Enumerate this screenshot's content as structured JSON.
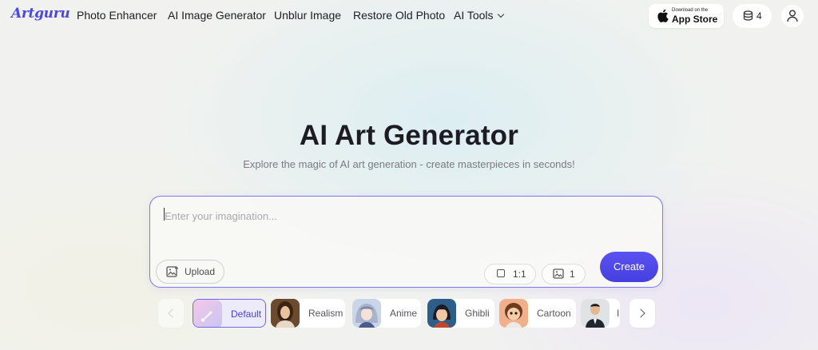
{
  "header": {
    "logo": "Artguru",
    "nav": [
      {
        "label": "Photo Enhancer"
      },
      {
        "label": "AI Image Generator"
      },
      {
        "label": "Unblur Image"
      },
      {
        "label": "Restore Old Photo"
      },
      {
        "label": "AI Tools"
      }
    ],
    "app_store": {
      "small": "Download on the",
      "big": "App Store"
    },
    "credits": "4"
  },
  "hero": {
    "title": "AI Art Generator",
    "subtitle": "Explore the magic of AI art generation - create masterpieces in seconds!"
  },
  "prompt": {
    "placeholder": "Enter your imagination...",
    "value": "",
    "upload_label": "Upload",
    "ratio_label": "1:1",
    "count_label": "1",
    "create_label": "Create"
  },
  "styles": {
    "selected": "Default",
    "items": [
      {
        "label": "Default"
      },
      {
        "label": "Realism"
      },
      {
        "label": "Anime"
      },
      {
        "label": "Ghibli"
      },
      {
        "label": "Cartoon"
      },
      {
        "label": "I"
      }
    ]
  },
  "colors": {
    "accent": "#4b46e6",
    "create_button": "#4f48e8",
    "selected_border": "#6e66ee"
  }
}
